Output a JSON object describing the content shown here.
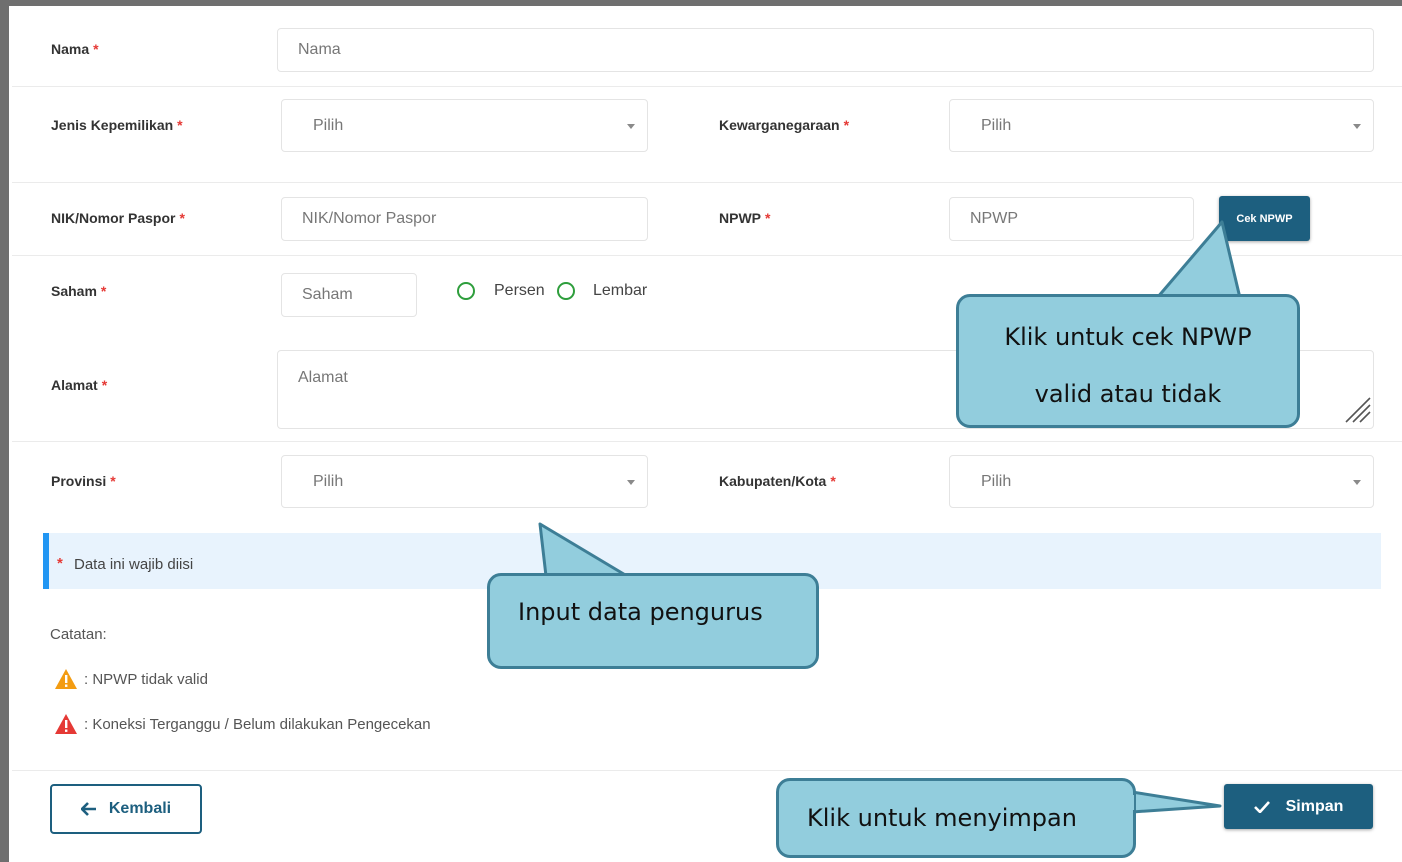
{
  "form": {
    "nama": {
      "label": "Nama",
      "req": "*",
      "placeholder": "Nama"
    },
    "jenis_kepemilikan": {
      "label": "Jenis Kepemilikan",
      "req": "*",
      "selected": "Pilih"
    },
    "kewarganegaraan": {
      "label": "Kewarganegaraan",
      "req": "*",
      "selected": "Pilih"
    },
    "nik": {
      "label": "NIK/Nomor Paspor",
      "req": "*",
      "placeholder": "NIK/Nomor Paspor"
    },
    "npwp": {
      "label": "NPWP",
      "req": "*",
      "placeholder": "NPWP",
      "button": "Cek NPWP"
    },
    "saham": {
      "label": "Saham",
      "req": "*",
      "placeholder": "Saham",
      "options": [
        "Persen",
        "Lembar"
      ]
    },
    "alamat": {
      "label": "Alamat",
      "req": "*",
      "placeholder": "Alamat"
    },
    "provinsi": {
      "label": "Provinsi",
      "req": "*",
      "selected": "Pilih"
    },
    "kabupaten": {
      "label": "Kabupaten/Kota",
      "req": "*",
      "selected": "Pilih"
    }
  },
  "notice": {
    "star": "*",
    "text": "Data ini wajib diisi"
  },
  "notes": {
    "title": "Catatan:",
    "items": [
      {
        "icon": "warning-orange-icon",
        "color": "#f39c12",
        "text": ": NPWP tidak valid"
      },
      {
        "icon": "warning-red-icon",
        "color": "#e53935",
        "text": ": Koneksi Terganggu / Belum dilakukan Pengecekan"
      }
    ]
  },
  "actions": {
    "back": "Kembali",
    "save": "Simpan"
  },
  "callouts": {
    "npwp_line1": "Klik untuk cek NPWP",
    "npwp_line2": "valid atau tidak",
    "input": "Input data pengurus",
    "save": "Klik untuk menyimpan"
  },
  "colors": {
    "primary": "#1d5f7f",
    "required": "#e53935",
    "notice_bg": "#e8f3fd",
    "notice_bar": "#2196f3",
    "radio": "#2e9e3c",
    "callout_fill": "#92cddd",
    "callout_border": "#3d7e96"
  }
}
